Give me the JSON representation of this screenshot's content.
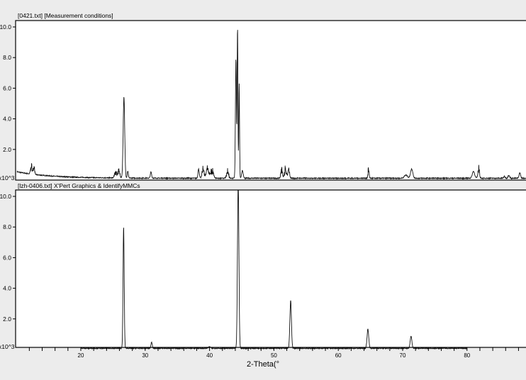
{
  "chart_data": [
    {
      "type": "line",
      "title": "[0421.txt] [Measurement conditions]",
      "ylabel_unit": "x10^3",
      "xlim": [
        10,
        89.3
      ],
      "ylim": [
        0,
        10.4
      ],
      "yticks": [
        "2.0",
        "4.0",
        "6.0",
        "8.0",
        "10.0"
      ],
      "baseline": 0.12,
      "start_level": 0.55,
      "peaks": [
        {
          "x": 12.3,
          "h": 0.6,
          "w": 0.12,
          "noisy": true
        },
        {
          "x": 12.7,
          "h": 0.5,
          "w": 0.12,
          "noisy": true
        },
        {
          "x": 25.4,
          "h": 0.45,
          "w": 0.15,
          "noisy": true
        },
        {
          "x": 25.9,
          "h": 0.55,
          "w": 0.15,
          "noisy": true
        },
        {
          "x": 26.7,
          "h": 5.3,
          "w": 0.12
        },
        {
          "x": 27.3,
          "h": 0.45,
          "w": 0.08
        },
        {
          "x": 30.9,
          "h": 0.4,
          "w": 0.1
        },
        {
          "x": 38.3,
          "h": 0.6,
          "w": 0.1
        },
        {
          "x": 39.0,
          "h": 0.8,
          "w": 0.15,
          "noisy": true
        },
        {
          "x": 39.7,
          "h": 0.7,
          "w": 0.2,
          "noisy": true
        },
        {
          "x": 40.4,
          "h": 0.6,
          "w": 0.2,
          "noisy": true
        },
        {
          "x": 42.8,
          "h": 0.6,
          "w": 0.15,
          "noisy": true
        },
        {
          "x": 44.1,
          "h": 7.8,
          "w": 0.08
        },
        {
          "x": 44.35,
          "h": 9.8,
          "w": 0.06
        },
        {
          "x": 44.6,
          "h": 6.2,
          "w": 0.06
        },
        {
          "x": 45.1,
          "h": 0.5,
          "w": 0.12
        },
        {
          "x": 51.2,
          "h": 0.7,
          "w": 0.12,
          "noisy": true
        },
        {
          "x": 51.8,
          "h": 0.7,
          "w": 0.15,
          "noisy": true
        },
        {
          "x": 52.3,
          "h": 0.6,
          "w": 0.12,
          "noisy": true
        },
        {
          "x": 64.7,
          "h": 0.7,
          "w": 0.08,
          "noisy": true
        },
        {
          "x": 70.5,
          "h": 0.2,
          "w": 0.25
        },
        {
          "x": 71.4,
          "h": 0.6,
          "w": 0.18
        },
        {
          "x": 81.0,
          "h": 0.45,
          "w": 0.18
        },
        {
          "x": 81.8,
          "h": 0.75,
          "w": 0.12,
          "noisy": true
        },
        {
          "x": 85.8,
          "h": 0.12,
          "w": 0.1
        },
        {
          "x": 86.5,
          "h": 0.2,
          "w": 0.12
        },
        {
          "x": 88.2,
          "h": 0.35,
          "w": 0.12
        }
      ]
    },
    {
      "type": "line",
      "title": "[lzh-0406.txt] X'Pert Graphics & IdentifyMMCs",
      "ylabel_unit": "x10^3",
      "xlim": [
        10,
        89.3
      ],
      "ylim": [
        0,
        10.4
      ],
      "x_range": [
        20,
        80
      ],
      "yticks": [
        "2.0",
        "4.0",
        "6.0",
        "8.0",
        "10.0"
      ],
      "baseline": 0.08,
      "peaks": [
        {
          "x": 26.65,
          "h": 7.9,
          "w": 0.09
        },
        {
          "x": 31.0,
          "h": 0.4,
          "w": 0.1
        },
        {
          "x": 40.0,
          "h": 0.08,
          "w": 0.2
        },
        {
          "x": 44.45,
          "h": 11.0,
          "w": 0.11
        },
        {
          "x": 52.6,
          "h": 3.1,
          "w": 0.12
        },
        {
          "x": 64.6,
          "h": 1.25,
          "w": 0.13
        },
        {
          "x": 71.3,
          "h": 0.8,
          "w": 0.13
        }
      ]
    }
  ],
  "x_axis": {
    "label": "2-Theta(°",
    "tick_labels": [
      "20",
      "30",
      "40",
      "50",
      "60",
      "70",
      "80"
    ]
  }
}
